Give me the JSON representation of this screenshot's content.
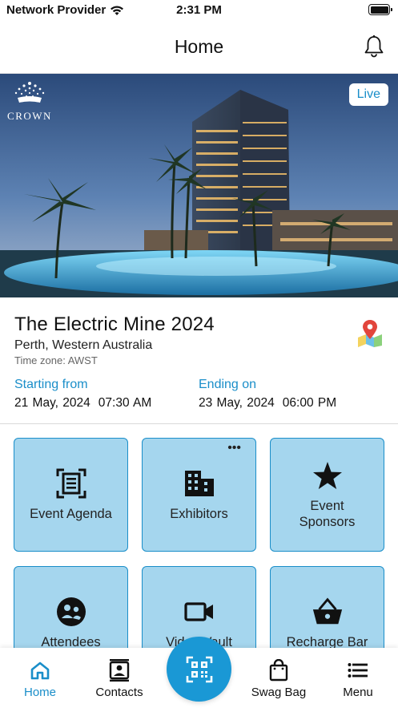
{
  "status_bar": {
    "carrier": "Network Provider",
    "time": "2:31 PM"
  },
  "header": {
    "title": "Home",
    "bell_icon": "bell-icon"
  },
  "hero": {
    "brand_text": "CROWN",
    "badge": "Live"
  },
  "event": {
    "title": "The Electric Mine 2024",
    "location": "Perth, Western Australia",
    "timezone": "Time zone: AWST",
    "start_label": "Starting from",
    "start_date": "21 May, 2024",
    "start_time": "07:30 AM",
    "end_label": "Ending on",
    "end_date": "23 May, 2024",
    "end_time": "06:00 PM",
    "map_icon": "map-pin-icon"
  },
  "tiles": [
    {
      "label": "Event Agenda",
      "icon": "agenda-icon"
    },
    {
      "label": "Exhibitors",
      "icon": "building-icon",
      "more": "•••"
    },
    {
      "label": "Event Sponsors",
      "icon": "star-icon"
    },
    {
      "label": "Attendees",
      "icon": "attendees-icon"
    },
    {
      "label": "Video Vault",
      "icon": "video-icon"
    },
    {
      "label": "Recharge Bar",
      "icon": "basket-icon"
    }
  ],
  "tabbar": {
    "items": [
      {
        "label": "Home",
        "icon": "home-icon",
        "active": true
      },
      {
        "label": "Contacts",
        "icon": "contacts-icon"
      },
      {
        "label": "Swag Bag",
        "icon": "shopping-bag-icon"
      },
      {
        "label": "Menu",
        "icon": "menu-icon"
      }
    ],
    "scan_icon": "qr-scan-icon"
  },
  "colors": {
    "accent": "#1a8ec9",
    "tile_bg": "#a5d6ee",
    "scan_button": "#1a98d5"
  }
}
